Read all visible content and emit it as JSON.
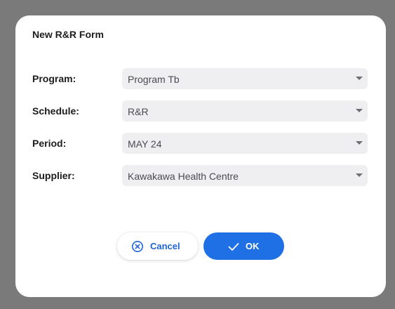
{
  "dialog": {
    "title": "New R&R Form"
  },
  "fields": [
    {
      "label": "Program:",
      "value": "Program Tb"
    },
    {
      "label": "Schedule:",
      "value": "R&R"
    },
    {
      "label": "Period:",
      "value": "MAY 24"
    },
    {
      "label": "Supplier:",
      "value": "Kawakawa Health Centre"
    }
  ],
  "buttons": {
    "cancel_label": "Cancel",
    "ok_label": "OK",
    "cancel_icon": "close-circle-icon",
    "ok_icon": "checkmark-icon"
  },
  "colors": {
    "accent": "#1f6fe5",
    "field_background": "#efeff2",
    "overlay": "#7a7a7a"
  }
}
